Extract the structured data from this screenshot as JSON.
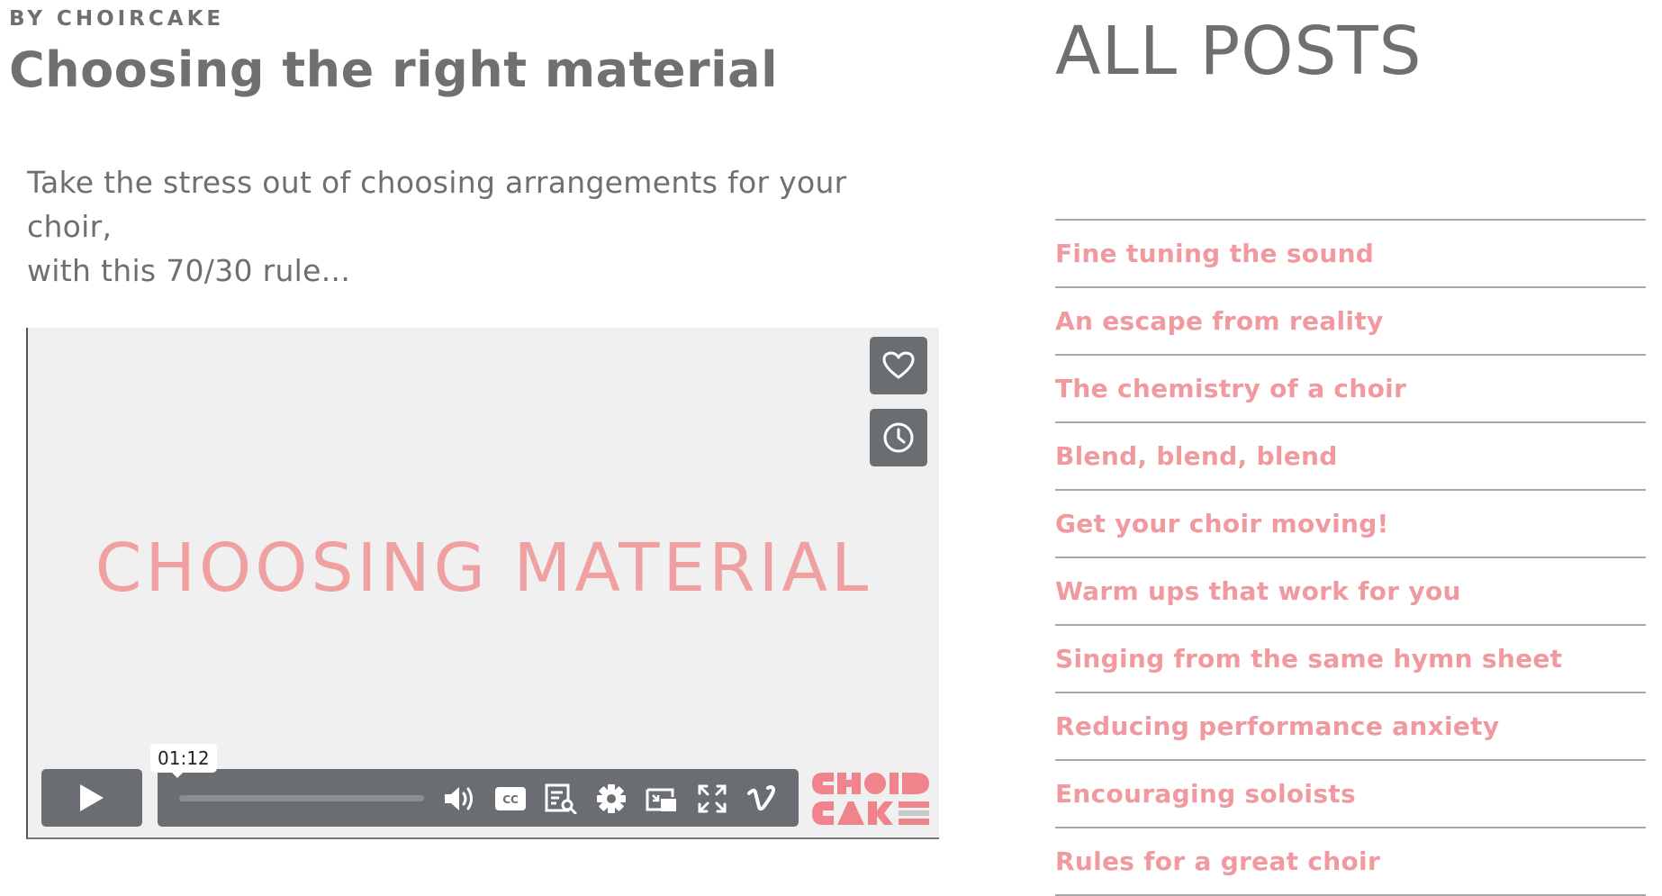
{
  "post": {
    "byline": "BY CHOIRCAKE",
    "title": "Choosing the right material",
    "intro_line1": "Take the stress out of choosing arrangements for your choir,",
    "intro_line2": "with this 70/30 rule..."
  },
  "video": {
    "title_card": "CHOOSING MATERIAL",
    "timestamp": "01:12",
    "progress": 0,
    "brand_logo_text": "CHOIR CAKE",
    "side_buttons": [
      "heart-icon",
      "clock-icon"
    ],
    "controls": [
      "play-icon",
      "volume-icon",
      "cc-icon",
      "transcript-icon",
      "settings-icon",
      "pip-icon",
      "fullscreen-icon",
      "vimeo-icon"
    ],
    "cc_label": "CC"
  },
  "sidebar": {
    "heading": "ALL POSTS",
    "posts": [
      "Fine tuning the sound",
      "An escape from reality",
      "The chemistry of a choir",
      "Blend, blend, blend",
      "Get your choir moving!",
      "Warm ups that work for you",
      "Singing from the same hymn sheet",
      "Reducing performance anxiety",
      "Encouraging soloists",
      "Rules for a great choir"
    ]
  },
  "colors": {
    "accent_pink": "#f09aa0",
    "text_gray": "#707070",
    "control_gray": "#6a6e73",
    "video_bg": "#f0f0f0"
  }
}
